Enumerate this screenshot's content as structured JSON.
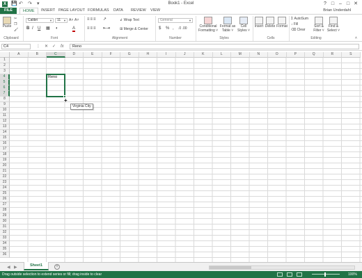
{
  "title_bar": {
    "logo": "X",
    "title": "Book1 - Excel",
    "qat_icons": [
      "save-icon",
      "undo-icon",
      "redo-icon",
      "customize-icon"
    ],
    "controls": [
      "?",
      "□",
      "–",
      "□",
      "✕"
    ]
  },
  "ribbon_tabs": {
    "file": "FILE",
    "tabs": [
      "HOME",
      "INSERT",
      "PAGE LAYOUT",
      "FORMULAS",
      "DATA",
      "REVIEW",
      "VIEW"
    ],
    "active": "HOME",
    "user": "Brian Underdahl"
  },
  "ribbon": {
    "clipboard": {
      "paste": "Paste",
      "label": "Clipboard"
    },
    "font": {
      "name": "Calibri",
      "size": "11",
      "label": "Font",
      "bold": "B",
      "italic": "I",
      "underline": "U",
      "grow": "A˄",
      "shrink": "A˅",
      "color_letter": "A",
      "highlight_letter": "A",
      "accent_red": "#c00000",
      "accent_yellow": "#ffd600"
    },
    "alignment": {
      "wrap": "Wrap Text",
      "merge": "Merge & Center",
      "label": "Alignment"
    },
    "number": {
      "format": "General",
      "currency": "$",
      "percent": "%",
      "comma": ",",
      "label": "Number"
    },
    "styles": {
      "conditional": [
        "Conditional",
        "Formatting ˅"
      ],
      "table": [
        "Format as",
        "Table ˅"
      ],
      "cell": [
        "Cell",
        "Styles ˅"
      ],
      "label": "Styles"
    },
    "cells": {
      "insert": "Insert",
      "delete": "Delete",
      "format": "Format",
      "label": "Cells"
    },
    "editing": {
      "autosum": "AutoSum",
      "fill": "Fill",
      "clear": "Clear",
      "sort": [
        "Sort &",
        "Filter ˅"
      ],
      "find": [
        "Find &",
        "Select ˅"
      ],
      "label": "Editing"
    }
  },
  "formula_bar": {
    "name_box": "C4",
    "cancel": "✕",
    "enter": "✓",
    "fx": "fx",
    "content": "Reno"
  },
  "grid": {
    "columns": [
      "A",
      "B",
      "C",
      "D",
      "E",
      "F",
      "G",
      "H",
      "I",
      "J",
      "K",
      "L",
      "M",
      "N",
      "O",
      "P",
      "Q",
      "R",
      "S"
    ],
    "rows": [
      "1",
      "2",
      "3",
      "4",
      "5",
      "6",
      "7",
      "8",
      "9",
      "10",
      "11",
      "12",
      "13",
      "14",
      "15",
      "16",
      "17",
      "18",
      "19",
      "20",
      "21",
      "22",
      "23",
      "24",
      "25",
      "26",
      "27",
      "28",
      "29",
      "30",
      "31",
      "32",
      "33",
      "34",
      "35",
      "36"
    ],
    "selected_column": "C",
    "selected_rows": [
      "4",
      "5",
      "6",
      "7"
    ],
    "cell_c4": "Reno",
    "autofill_tip": "Virginia City"
  },
  "sheets": {
    "tabs": [
      "Sheet1"
    ],
    "active": "Sheet1",
    "add": "+"
  },
  "status_bar": {
    "message": "Drag outside selection to extend series or fill; drag inside to clear",
    "zoom": "100%",
    "color": "#217346"
  }
}
